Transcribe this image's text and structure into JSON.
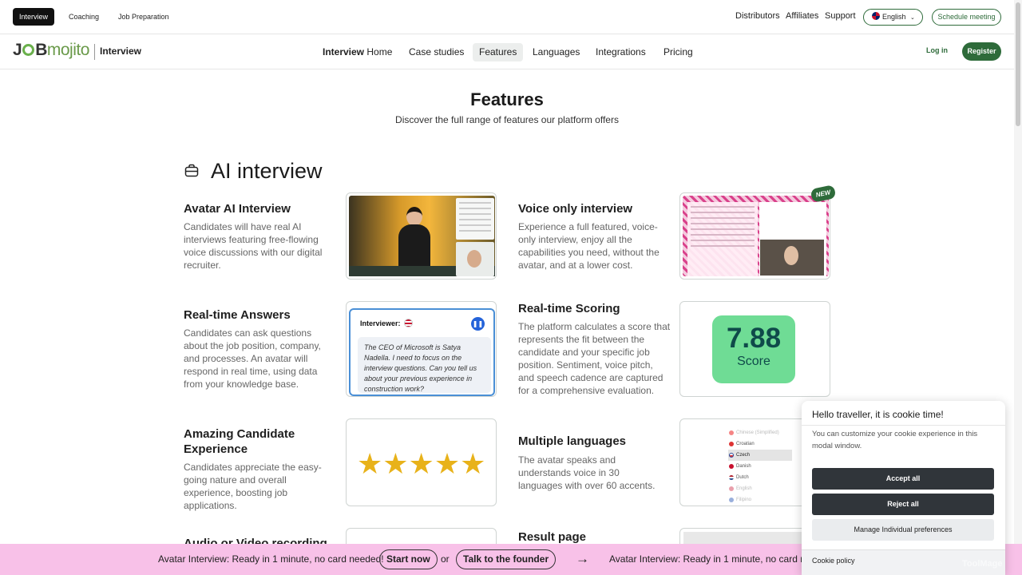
{
  "top_bar": {
    "tabs": [
      "Interview",
      "Coaching",
      "Job Preparation"
    ],
    "links": [
      "Distributors",
      "Affiliates",
      "Support"
    ],
    "language": "English",
    "schedule_label": "Schedule meeting"
  },
  "nav": {
    "logo_text_bold": "J",
    "logo_text_bold2": "B",
    "logo_text_light": "mojito",
    "logo_sub": "Interview",
    "home_bold": "Interview",
    "home_rest": "Home",
    "items": [
      "Case studies",
      "Features",
      "Languages",
      "Integrations",
      "Pricing"
    ],
    "active": "Features",
    "login": "Log in",
    "register": "Register"
  },
  "header": {
    "title": "Features",
    "subtitle": "Discover the full range of features our platform offers"
  },
  "section": {
    "title": "AI interview",
    "icon": "briefcase-icon"
  },
  "features": [
    {
      "title": "Avatar AI Interview",
      "desc": "Candidates will have real AI interviews featuring free-flowing voice discussions with our digital recruiter."
    },
    {
      "title": "Voice only interview",
      "desc": "Experience a full featured, voice-only interview, enjoy all the capabilities you need, without the avatar, and at a lower cost.",
      "badge": "NEW"
    },
    {
      "title": "Real-time Answers",
      "desc": "Candidates can ask questions about the job position, company, and processes. An avatar will respond in real time, using data from your knowledge base."
    },
    {
      "title": "Real-time Scoring",
      "desc": "The platform calculates a score that represents the fit between the candidate and your specific job position. Sentiment, voice pitch, and speech cadence are captured for a comprehensive evaluation."
    },
    {
      "title": "Amazing Candidate Experience",
      "desc": "Candidates appreciate the easy-going nature and overall experience, boosting job applications."
    },
    {
      "title": "Multiple languages",
      "desc": "The avatar speaks and understands voice in 30 languages with over 60 accents."
    },
    {
      "title": "Audio or Video recording",
      "desc": ""
    },
    {
      "title": "Result page",
      "desc": ""
    }
  ],
  "realtime_card": {
    "label": "Interviewer:",
    "quote": "The CEO of Microsoft is Satya Nadella. I need to focus on the interview questions. Can you tell us about your previous experience in construction work?"
  },
  "score_card": {
    "value": "7.88",
    "label": "Score"
  },
  "stars_card": {
    "rating": 5,
    "max": 5,
    "glyphs": "★★★★★"
  },
  "languages_card": {
    "items": [
      "Chinese (Simplified)",
      "Croatian",
      "Czech",
      "Danish",
      "Dutch",
      "English",
      "Filipino"
    ],
    "selected": "Czech"
  },
  "cookie": {
    "title": "Hello traveller, it is cookie time!",
    "text": "You can customize your cookie experience in this modal window.",
    "accept": "Accept all",
    "reject": "Reject all",
    "manage": "Manage Individual preferences",
    "policy": "Cookie policy"
  },
  "banner": {
    "text": "Avatar Interview: Ready in 1 minute, no card needed!",
    "start": "Start now",
    "or": "or",
    "founder": "Talk to the founder",
    "text_repeat": "Avatar Interview: Ready in 1 minute, no card ne"
  },
  "watermark": "ToolMage"
}
